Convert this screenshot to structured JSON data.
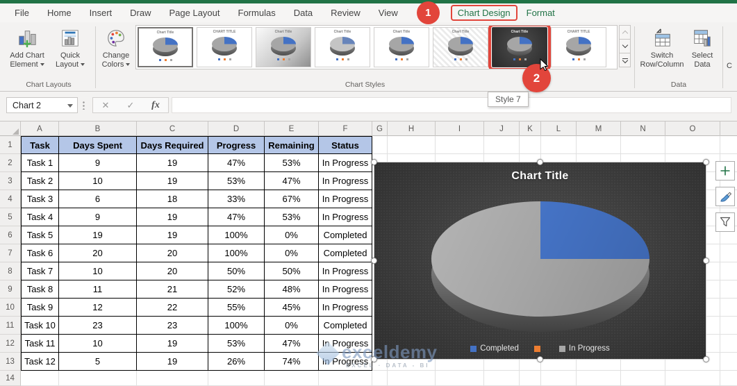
{
  "annotations": {
    "step1": "1",
    "step2": "2",
    "tooltip": "Style 7"
  },
  "tabs": [
    {
      "label": "File"
    },
    {
      "label": "Home"
    },
    {
      "label": "Insert"
    },
    {
      "label": "Draw"
    },
    {
      "label": "Page Layout"
    },
    {
      "label": "Formulas"
    },
    {
      "label": "Data"
    },
    {
      "label": "Review"
    },
    {
      "label": "View"
    },
    {
      "label": "Chart Design",
      "style": "contextual",
      "highlighted": true,
      "badge_before": true
    },
    {
      "label": "Format",
      "style": "contextual"
    }
  ],
  "ribbon": {
    "groups": {
      "chart_layouts": {
        "label": "Chart Layouts",
        "buttons": [
          "Add Chart Element",
          "Quick Layout"
        ]
      },
      "chart_styles": {
        "label": "Chart Styles",
        "change_colors": "Change Colors",
        "thumb_title": "Chart Title",
        "styles": [
          {
            "name": "Style 1",
            "variant": "white",
            "selected": true
          },
          {
            "name": "Style 2",
            "variant": "caps"
          },
          {
            "name": "Style 3",
            "variant": "gray"
          },
          {
            "name": "Style 4",
            "variant": "pale"
          },
          {
            "name": "Style 5",
            "variant": "white"
          },
          {
            "name": "Style 6",
            "variant": "hatch"
          },
          {
            "name": "Style 7",
            "variant": "dark",
            "highlighted": true
          },
          {
            "name": "Style 8",
            "variant": "caps"
          }
        ]
      },
      "data": {
        "label": "Data",
        "buttons": [
          "Switch Row/Column",
          "Select Data"
        ]
      },
      "clipped_label": "C"
    }
  },
  "formula_bar": {
    "name_box": "Chart 2",
    "cancel_glyph": "✕",
    "enter_glyph": "✓",
    "fx_label": "fx",
    "formula_value": ""
  },
  "sheet": {
    "columns": [
      "A",
      "B",
      "C",
      "D",
      "E",
      "F",
      "G",
      "H",
      "I",
      "J",
      "K",
      "L",
      "M",
      "N",
      "O"
    ],
    "row_count": 14,
    "table": {
      "headers": [
        "Task",
        "Days Spent",
        "Days Required",
        "Progress",
        "Remaining",
        "Status"
      ],
      "header_fill": "#b4c6e7",
      "rows": [
        [
          "Task 1",
          "9",
          "19",
          "47%",
          "53%",
          "In Progress"
        ],
        [
          "Task 2",
          "10",
          "19",
          "53%",
          "47%",
          "In Progress"
        ],
        [
          "Task 3",
          "6",
          "18",
          "33%",
          "67%",
          "In Progress"
        ],
        [
          "Task 4",
          "9",
          "19",
          "47%",
          "53%",
          "In Progress"
        ],
        [
          "Task 5",
          "19",
          "19",
          "100%",
          "0%",
          "Completed"
        ],
        [
          "Task 6",
          "20",
          "20",
          "100%",
          "0%",
          "Completed"
        ],
        [
          "Task 7",
          "10",
          "20",
          "50%",
          "50%",
          "In Progress"
        ],
        [
          "Task 8",
          "11",
          "21",
          "52%",
          "48%",
          "In Progress"
        ],
        [
          "Task 9",
          "12",
          "22",
          "55%",
          "45%",
          "In Progress"
        ],
        [
          "Task 10",
          "23",
          "23",
          "100%",
          "0%",
          "Completed"
        ],
        [
          "Task 11",
          "10",
          "19",
          "53%",
          "47%",
          "In Progress"
        ],
        [
          "Task 12",
          "5",
          "19",
          "26%",
          "74%",
          "In Progress"
        ]
      ]
    }
  },
  "chart_data": {
    "type": "pie",
    "title": "Chart Title",
    "categories": [
      "Completed",
      "In Progress"
    ],
    "values": [
      25,
      75
    ],
    "unit": "percent",
    "colors": [
      "#4472c4",
      "#a6a6a6"
    ],
    "style": "3d-pie",
    "background": "#3a3a3a",
    "legend_position": "bottom",
    "legend": [
      {
        "label": "Completed",
        "color": "#4472c4"
      },
      {
        "label": "",
        "color": "#ed7d31"
      },
      {
        "label": "In Progress",
        "color": "#a6a6a6"
      }
    ]
  },
  "watermark": {
    "brand": "exceldemy",
    "tagline": "EXCEL · DATA - BI"
  }
}
